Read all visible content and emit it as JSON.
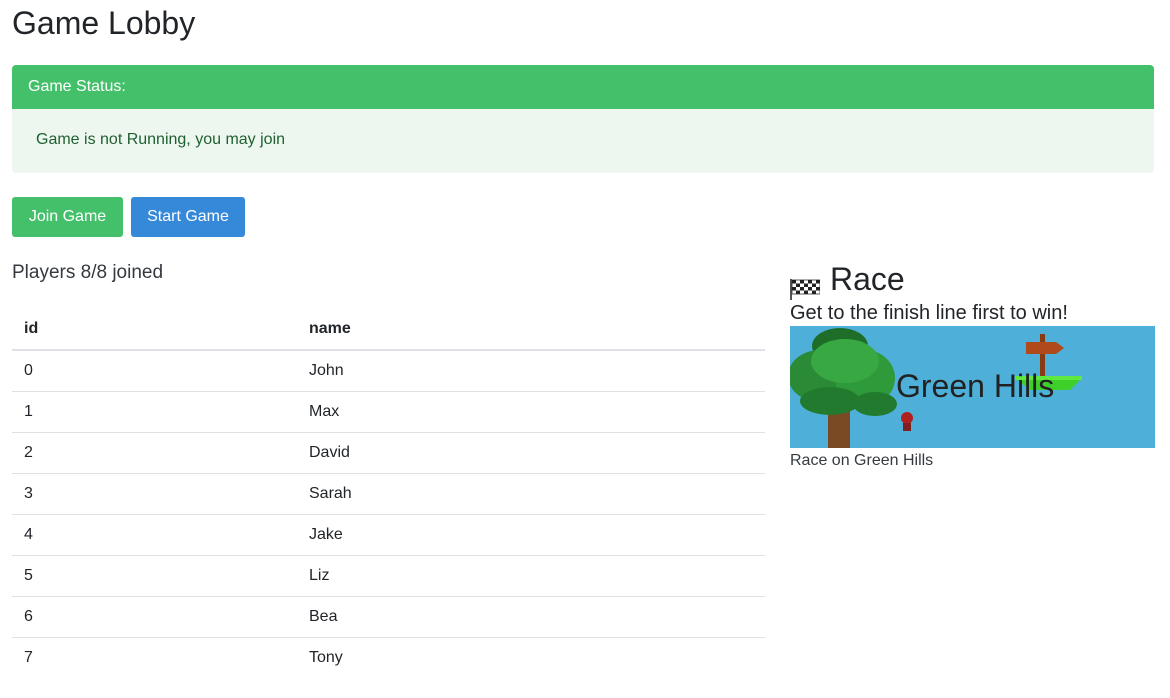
{
  "page": {
    "title": "Game Lobby"
  },
  "status": {
    "header": "Game Status:",
    "message": "Game is not Running, you may join"
  },
  "actions": {
    "join_label": "Join Game",
    "start_label": "Start Game"
  },
  "players": {
    "heading": "Players 8/8 joined",
    "columns": [
      "id",
      "name"
    ],
    "rows": [
      {
        "id": "0",
        "name": "John"
      },
      {
        "id": "1",
        "name": "Max"
      },
      {
        "id": "2",
        "name": "David"
      },
      {
        "id": "3",
        "name": "Sarah"
      },
      {
        "id": "4",
        "name": "Jake"
      },
      {
        "id": "5",
        "name": "Liz"
      },
      {
        "id": "6",
        "name": "Bea"
      },
      {
        "id": "7",
        "name": "Tony"
      }
    ]
  },
  "game": {
    "icon": "checkered-flag-icon",
    "title": "Race",
    "description": "Get to the finish line first to win!",
    "map_label": "Green Hills",
    "map_caption": "Race on Green Hills"
  },
  "colors": {
    "success": "#45c06a",
    "primary": "#3689d9",
    "status_bg": "#edf7ef",
    "status_text": "#1f5f30",
    "map_sky": "#4eb0d8"
  }
}
